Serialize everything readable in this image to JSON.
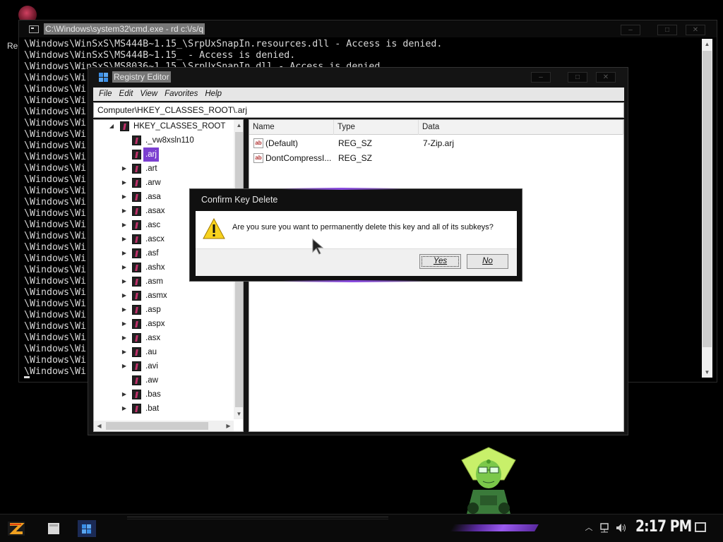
{
  "desktop": {
    "icon_label": "Re"
  },
  "cmd": {
    "title": "C:\\Windows\\system32\\cmd.exe - rd  c:\\/s/q",
    "controls": [
      "–",
      "□",
      "✕"
    ],
    "lines": [
      "\\Windows\\WinSxS\\MS444B~1.15_\\SrpUxSnapIn.resources.dll - Access is denied.",
      "\\Windows\\WinSxS\\MS444B~1.15_ - Access is denied.",
      "\\Windows\\WinSxS\\MS8036~1.15_\\SrpUxSnapIn.dll - Access is denied.",
      "\\Windows\\Wi",
      "\\Windows\\Wi",
      "\\Windows\\Wi",
      "\\Windows\\Wi",
      "\\Windows\\Wi",
      "\\Windows\\Wi",
      "\\Windows\\Wi",
      "\\Windows\\Wi",
      "\\Windows\\Wi",
      "\\Windows\\Wi",
      "\\Windows\\Wi",
      "\\Windows\\Wi",
      "\\Windows\\Wi",
      "\\Windows\\Wi",
      "\\Windows\\Wi",
      "\\Windows\\Wi",
      "\\Windows\\Wi",
      "\\Windows\\Wi",
      "\\Windows\\Wi",
      "\\Windows\\Wi",
      "\\Windows\\Wi",
      "\\Windows\\Wi",
      "\\Windows\\Wi",
      "\\Windows\\Wi",
      "\\Windows\\Wi",
      "\\Windows\\Wi",
      "\\Windows\\Wi"
    ]
  },
  "regedit": {
    "title": "Registry Editor",
    "controls": [
      "–",
      "□",
      "✕"
    ],
    "menu": [
      "File",
      "Edit",
      "View",
      "Favorites",
      "Help"
    ],
    "address": "Computer\\HKEY_CLASSES_ROOT\\.arj",
    "tree": {
      "root": "HKEY_CLASSES_ROOT",
      "items": [
        "._vw8xsln110",
        ".arj",
        ".art",
        ".arw",
        ".asa",
        ".asax",
        ".asc",
        ".ascx",
        ".asf",
        ".ashx",
        ".asm",
        ".asmx",
        ".asp",
        ".aspx",
        ".asx",
        ".au",
        ".avi",
        ".aw",
        ".bas",
        ".bat"
      ],
      "expandable": [
        false,
        false,
        true,
        true,
        true,
        true,
        true,
        true,
        true,
        true,
        true,
        true,
        true,
        true,
        true,
        true,
        true,
        false,
        true,
        true
      ],
      "selected": ".arj"
    },
    "list": {
      "columns": [
        "Name",
        "Type",
        "Data"
      ],
      "rows": [
        {
          "icon": "ab",
          "name": "(Default)",
          "type": "REG_SZ",
          "data": "7-Zip.arj"
        },
        {
          "icon": "ab",
          "name": "DontCompressI...",
          "type": "REG_SZ",
          "data": ""
        }
      ]
    }
  },
  "dialog": {
    "title": "Confirm Key Delete",
    "message": "Are you sure you want to permanently delete this key and all of its subkeys?",
    "yes_label": "Yes",
    "no_label": "No",
    "icon": "warning-icon"
  },
  "taskbar": {
    "clock": "2:17 PM",
    "tray_icons": [
      "chevron-up-icon",
      "network-icon",
      "speaker-icon",
      "notification-icon"
    ],
    "accent_color": "#8a4ae0"
  }
}
